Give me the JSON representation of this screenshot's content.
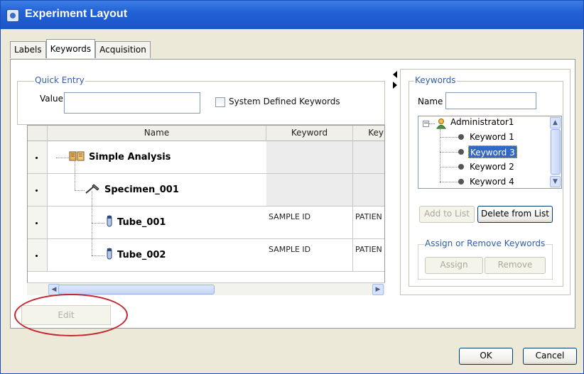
{
  "window": {
    "title": "Experiment Layout"
  },
  "tabs": [
    {
      "label": "Labels",
      "active": false
    },
    {
      "label": "Keywords",
      "active": true
    },
    {
      "label": "Acquisition",
      "active": false
    }
  ],
  "quick_entry": {
    "legend": "Quick Entry",
    "value_label": "Value",
    "value": "",
    "checkbox_label": "System Defined Keywords",
    "checkbox_checked": false
  },
  "grid": {
    "columns": [
      "Name",
      "Keyword",
      "Key"
    ],
    "rows": [
      {
        "name": "Simple Analysis",
        "icon": "book-icon",
        "keyword": "",
        "keyword2": ""
      },
      {
        "name": "Specimen_001",
        "icon": "pipette-icon",
        "keyword": "",
        "keyword2": ""
      },
      {
        "name": "Tube_001",
        "icon": "tube-icon",
        "keyword": "SAMPLE ID",
        "keyword2": "PATIEN"
      },
      {
        "name": "Tube_002",
        "icon": "tube-icon",
        "keyword": "SAMPLE ID",
        "keyword2": "PATIEN"
      }
    ]
  },
  "keywords_panel": {
    "legend": "Keywords",
    "name_label": "Name",
    "name_value": "",
    "tree": {
      "root": "Administrator1",
      "items": [
        {
          "label": "Keyword 1",
          "selected": false
        },
        {
          "label": "Keyword 3",
          "selected": true
        },
        {
          "label": "Keyword 2",
          "selected": false
        },
        {
          "label": "Keyword 4",
          "selected": false
        }
      ]
    },
    "add_to_list_label": "Add to List",
    "delete_from_list_label": "Delete from List",
    "assign_group_legend": "Assign or Remove Keywords",
    "assign_label": "Assign",
    "remove_label": "Remove"
  },
  "edit_label": "Edit",
  "footer": {
    "ok_label": "OK",
    "cancel_label": "Cancel"
  },
  "colors": {
    "title_bar": "#2161d6",
    "selection": "#316ac5",
    "annotation": "#c6262e",
    "legend_text": "#2f5ea8"
  }
}
